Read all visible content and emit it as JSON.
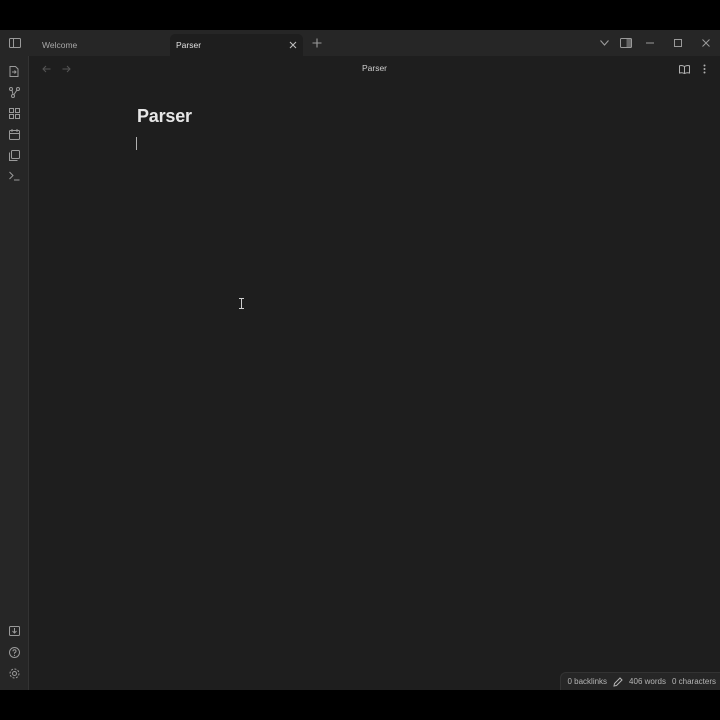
{
  "tabs": [
    {
      "label": "Welcome",
      "active": false
    },
    {
      "label": "Parser",
      "active": true
    }
  ],
  "view_header": {
    "title": "Parser"
  },
  "note": {
    "title": "Parser"
  },
  "status_bar": {
    "backlinks": "0 backlinks",
    "words": "406 words",
    "characters": "0 characters"
  },
  "icons": {
    "titlebar": [
      "sidebar-toggle-icon",
      "new-tab-icon",
      "tab-list-chevron-icon",
      "right-sidebar-toggle-icon",
      "minimize-icon",
      "maximize-icon",
      "close-window-icon"
    ],
    "ribbon_top": [
      "open-quick-switcher-icon",
      "graph-view-icon",
      "canvas-icon",
      "daily-note-icon",
      "templates-icon",
      "command-palette-icon"
    ],
    "ribbon_bottom": [
      "open-vault-icon",
      "help-icon",
      "settings-icon"
    ],
    "view_header": [
      "back-arrow-icon",
      "forward-arrow-icon",
      "reading-view-icon",
      "more-options-icon"
    ]
  },
  "colors": {
    "background": "#1e1e1e",
    "chrome": "#262626",
    "text": "#dadada"
  }
}
